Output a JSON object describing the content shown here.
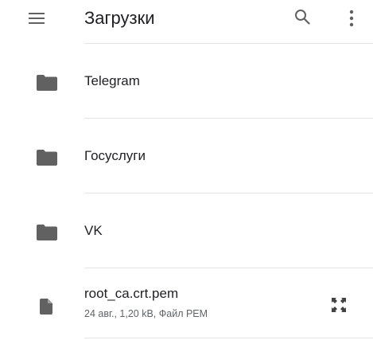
{
  "appbar": {
    "menu_icon": "hamburger-menu-icon",
    "title": "Загрузки",
    "search_icon": "search-icon",
    "more_icon": "more-vert-icon"
  },
  "items": [
    {
      "type": "folder",
      "icon": "folder-icon",
      "label": "Telegram"
    },
    {
      "type": "folder",
      "icon": "folder-icon",
      "label": "Госуслуги"
    },
    {
      "type": "folder",
      "icon": "folder-icon",
      "label": "VK"
    },
    {
      "type": "file",
      "icon": "file-icon",
      "label": "root_ca.crt.pem",
      "meta": "24 авг., 1,20 kB, Файл PEM",
      "action_icon": "expand-icon"
    }
  ],
  "colors": {
    "text": "#202124",
    "secondary_text": "#5f6368",
    "icon": "#616161",
    "divider": "#e4e4e4",
    "background": "#ffffff"
  }
}
